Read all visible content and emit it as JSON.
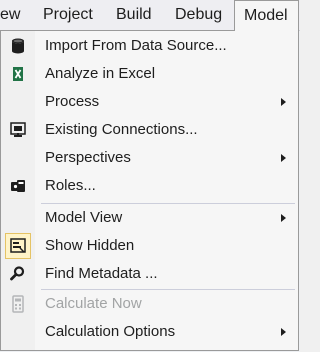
{
  "menubar": {
    "items": [
      {
        "label": "ew"
      },
      {
        "label": "Project"
      },
      {
        "label": "Build"
      },
      {
        "label": "Debug"
      },
      {
        "label": "Model"
      }
    ]
  },
  "menu": {
    "items": [
      {
        "label": "Import From Data Source...",
        "icon": "database-icon"
      },
      {
        "label": "Analyze in Excel",
        "icon": "excel-icon"
      },
      {
        "label": "Process",
        "submenu": true
      },
      {
        "label": "Existing Connections...",
        "icon": "connections-icon"
      },
      {
        "label": "Perspectives",
        "submenu": true
      },
      {
        "label": "Roles...",
        "icon": "roles-icon"
      },
      {
        "label": "Model View",
        "submenu": true
      },
      {
        "label": "Show Hidden",
        "icon": "show-hidden-icon",
        "checked": true
      },
      {
        "label": "Find Metadata ...",
        "icon": "find-icon"
      },
      {
        "label": "Calculate Now",
        "icon": "calculator-icon",
        "disabled": true
      },
      {
        "label": "Calculation Options",
        "submenu": true
      }
    ]
  },
  "colors": {
    "text": "#1e1e1e",
    "disabled_text": "#a2a4a5",
    "excel_green": "#217346",
    "check_highlight": "#fff4c8"
  }
}
